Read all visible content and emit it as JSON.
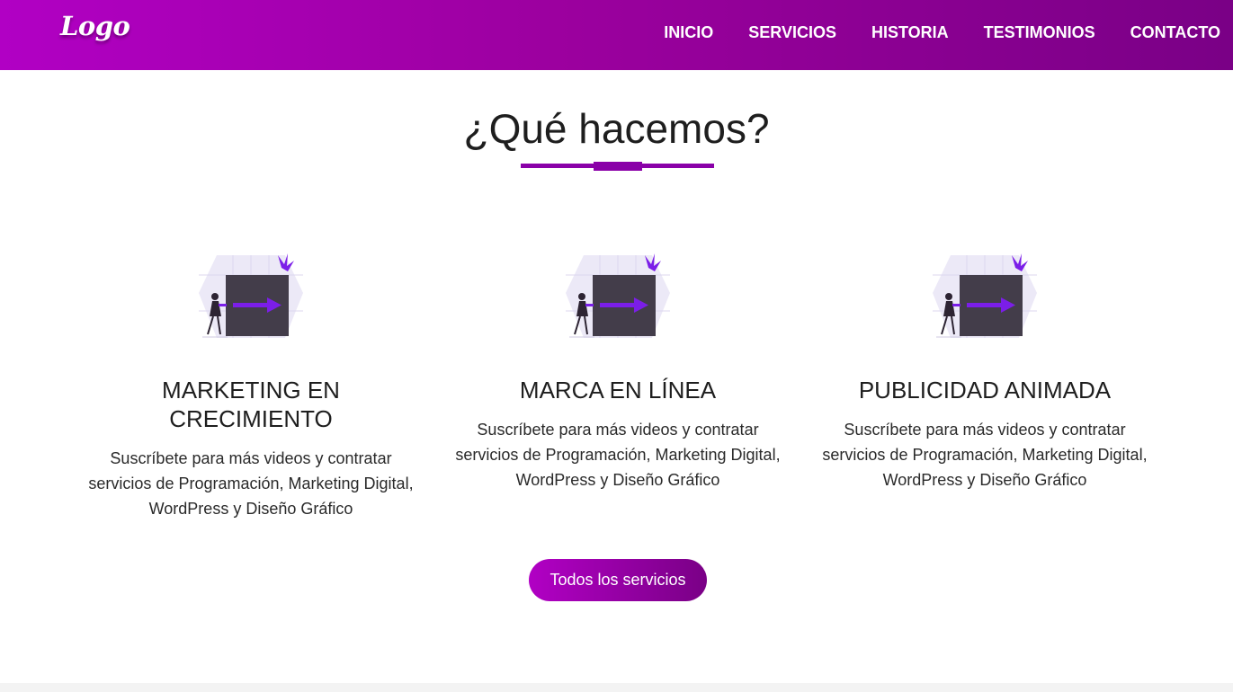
{
  "header": {
    "logo": "Logo",
    "nav": [
      "INICIO",
      "SERVICIOS",
      "HISTORIA",
      "TESTIMONIOS",
      "CONTACTO"
    ]
  },
  "section": {
    "title": "¿Qué hacemos?",
    "accent_color": "#8a00a8"
  },
  "cards": [
    {
      "title": "MARKETING EN CRECIMIENTO",
      "text": "Suscríbete para más videos y contratar servicios de Programación, Marketing Digital, WordPress y Diseño Gráfico",
      "icon": "illustration-woman-pushing-box-icon"
    },
    {
      "title": "MARCA EN LÍNEA",
      "text": "Suscríbete para más videos y contratar servicios de Programación, Marketing Digital, WordPress y Diseño Gráfico",
      "icon": "illustration-woman-pushing-box-icon"
    },
    {
      "title": "PUBLICIDAD ANIMADA",
      "text": "Suscríbete para más videos y contratar servicios de Programación, Marketing Digital, WordPress y Diseño Gráfico",
      "icon": "illustration-woman-pushing-box-icon"
    }
  ],
  "cta": {
    "label": "Todos los servicios"
  },
  "colors": {
    "brand_start": "#b100c4",
    "brand_end": "#7a0086",
    "arrow": "#7b1ee8",
    "box": "#433d4a"
  }
}
